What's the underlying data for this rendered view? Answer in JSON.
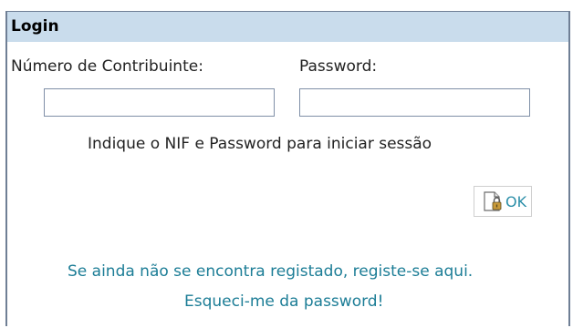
{
  "login": {
    "title": "Login",
    "nif_label": "Número de Contribuinte:",
    "password_label": "Password:",
    "nif_value": "",
    "password_value": "",
    "hint": "Indique o NIF e Password para iniciar sessão",
    "ok_label": "OK",
    "register_link": "Se ainda não se encontra registado, registe-se aqui.",
    "forgot_link": "Esqueci-me da password!"
  },
  "colors": {
    "header_bg": "#c9dcec",
    "link": "#1c7d96",
    "border": "#6f7f95"
  },
  "icons": {
    "ok_button_icon": "document-lock-icon"
  }
}
